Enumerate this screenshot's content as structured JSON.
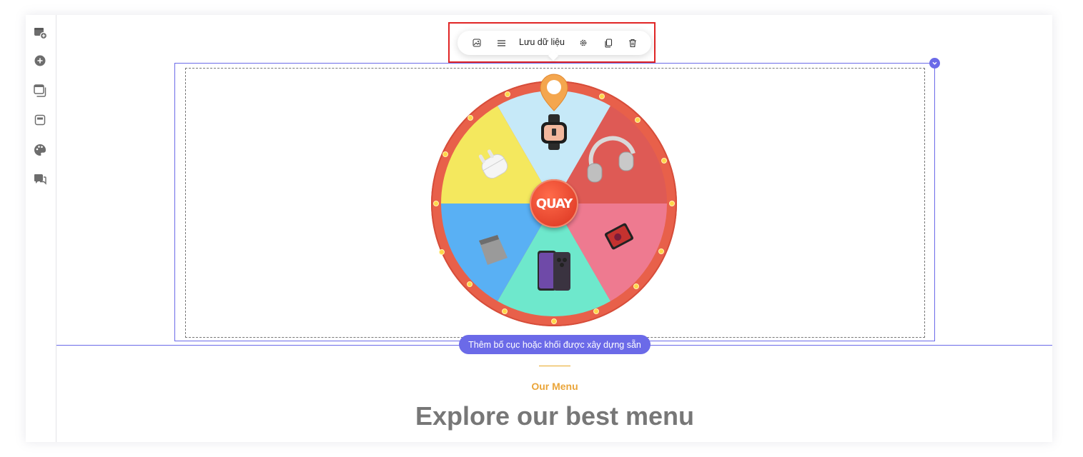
{
  "sidebar": {
    "items": [
      {
        "icon": "add-section-icon"
      },
      {
        "icon": "add-element-icon"
      },
      {
        "icon": "layers-icon"
      },
      {
        "icon": "page-icon"
      },
      {
        "icon": "palette-icon"
      },
      {
        "icon": "chat-icon"
      }
    ]
  },
  "toolbar": {
    "image_icon": "image-icon",
    "menu_icon": "menu-icon",
    "save_label": "Lưu dữ liệu",
    "settings_icon": "gear-icon",
    "duplicate_icon": "duplicate-icon",
    "delete_icon": "trash-icon"
  },
  "wheel": {
    "center_label": "QUAY",
    "rim_color": "#e8604a",
    "segments": [
      {
        "prize": "smartwatch",
        "color": "#c6e9f8"
      },
      {
        "prize": "headphones",
        "color": "#de5a55"
      },
      {
        "prize": "tablet",
        "color": "#ee7a90"
      },
      {
        "prize": "smartphone",
        "color": "#6ee8cc"
      },
      {
        "prize": "laptop",
        "color": "#59b0f4"
      },
      {
        "prize": "earbuds",
        "color": "#f4e85e"
      }
    ]
  },
  "add_layout_button": "Thêm bố cục hoặc khối được xây dựng sẵn",
  "section": {
    "eyebrow": "Our Menu",
    "heading": "Explore our best menu"
  },
  "colors": {
    "accent": "#6b6ae8",
    "highlight": "#e02525",
    "gold": "#eaa53a"
  }
}
